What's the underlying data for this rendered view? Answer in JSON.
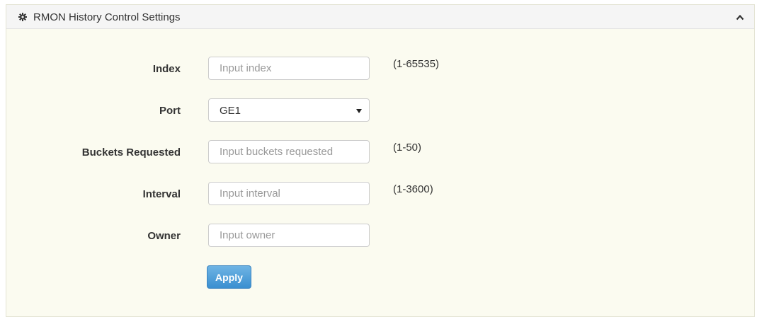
{
  "panel": {
    "title": "RMON History Control Settings",
    "icon": "gear-icon",
    "collapse_icon": "chevron-up-icon"
  },
  "form": {
    "index": {
      "label": "Index",
      "placeholder": "Input index",
      "hint": "(1-65535)"
    },
    "port": {
      "label": "Port",
      "selected": "GE1"
    },
    "buckets": {
      "label": "Buckets Requested",
      "placeholder": "Input buckets requested",
      "hint": "(1-50)"
    },
    "interval": {
      "label": "Interval",
      "placeholder": "Input interval",
      "hint": "(1-3600)"
    },
    "owner": {
      "label": "Owner",
      "placeholder": "Input owner"
    }
  },
  "actions": {
    "apply_label": "Apply"
  },
  "colors": {
    "panel_bg": "#fbfbf0",
    "header_bg": "#f5f5f5",
    "button_primary": "#4a9ad9"
  }
}
